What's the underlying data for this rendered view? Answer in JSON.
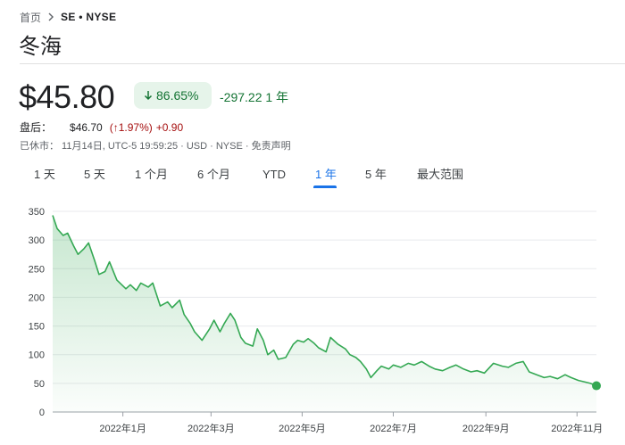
{
  "breadcrumb": {
    "home": "首页",
    "ticker": "SE • NYSE"
  },
  "company": {
    "name": "冬海"
  },
  "quote": {
    "price": "$45.80",
    "change_pct": "86.65%",
    "change_abs": "-297.22 1 年"
  },
  "after_hours": {
    "label": "盘后：",
    "price": "$46.70",
    "pct": "(↑1.97%)",
    "abs": "+0.90"
  },
  "meta": {
    "text": "已休市： 11月14日, UTC-5 19:59:25 · USD · NYSE · 免责声明"
  },
  "tabs": [
    {
      "label": "1 天"
    },
    {
      "label": "5 天"
    },
    {
      "label": "1 个月"
    },
    {
      "label": "6 个月"
    },
    {
      "label": "YTD"
    },
    {
      "label": "1 年",
      "active": true
    },
    {
      "label": "5 年"
    },
    {
      "label": "最大范围"
    }
  ],
  "colors": {
    "up_green": "#137333",
    "line_green": "#34a853",
    "down_red": "#a50e0e",
    "accent_blue": "#1a73e8"
  },
  "chart_data": {
    "type": "area",
    "ylim": [
      0,
      350
    ],
    "yticks": [
      0,
      50,
      100,
      150,
      200,
      250,
      300,
      350
    ],
    "xticks": [
      "2022年1月",
      "2022年3月",
      "2022年5月",
      "2022年7月",
      "2022年9月",
      "2022年11月"
    ],
    "x_range": [
      "2021-11-15",
      "2022-11-14"
    ],
    "xtick_dates": [
      "2022-01-01",
      "2022-03-01",
      "2022-05-01",
      "2022-07-01",
      "2022-09-01",
      "2022-11-01"
    ],
    "series": [
      {
        "points": [
          [
            "2021-11-15",
            343
          ],
          [
            "2021-11-18",
            320
          ],
          [
            "2021-11-22",
            308
          ],
          [
            "2021-11-25",
            312
          ],
          [
            "2021-11-29",
            290
          ],
          [
            "2021-12-02",
            275
          ],
          [
            "2021-12-06",
            285
          ],
          [
            "2021-12-09",
            295
          ],
          [
            "2021-12-13",
            265
          ],
          [
            "2021-12-16",
            240
          ],
          [
            "2021-12-20",
            245
          ],
          [
            "2021-12-23",
            262
          ],
          [
            "2021-12-28",
            230
          ],
          [
            "2022-01-03",
            215
          ],
          [
            "2022-01-06",
            222
          ],
          [
            "2022-01-10",
            212
          ],
          [
            "2022-01-13",
            225
          ],
          [
            "2022-01-18",
            218
          ],
          [
            "2022-01-21",
            225
          ],
          [
            "2022-01-26",
            185
          ],
          [
            "2022-01-31",
            192
          ],
          [
            "2022-02-03",
            182
          ],
          [
            "2022-02-08",
            195
          ],
          [
            "2022-02-11",
            170
          ],
          [
            "2022-02-15",
            155
          ],
          [
            "2022-02-18",
            140
          ],
          [
            "2022-02-23",
            125
          ],
          [
            "2022-02-28",
            145
          ],
          [
            "2022-03-03",
            160
          ],
          [
            "2022-03-07",
            140
          ],
          [
            "2022-03-10",
            155
          ],
          [
            "2022-03-14",
            172
          ],
          [
            "2022-03-17",
            160
          ],
          [
            "2022-03-21",
            130
          ],
          [
            "2022-03-24",
            120
          ],
          [
            "2022-03-29",
            115
          ],
          [
            "2022-04-01",
            145
          ],
          [
            "2022-04-05",
            125
          ],
          [
            "2022-04-08",
            100
          ],
          [
            "2022-04-12",
            108
          ],
          [
            "2022-04-15",
            92
          ],
          [
            "2022-04-20",
            95
          ],
          [
            "2022-04-25",
            118
          ],
          [
            "2022-04-28",
            125
          ],
          [
            "2022-05-02",
            122
          ],
          [
            "2022-05-05",
            128
          ],
          [
            "2022-05-09",
            120
          ],
          [
            "2022-05-12",
            112
          ],
          [
            "2022-05-17",
            105
          ],
          [
            "2022-05-20",
            130
          ],
          [
            "2022-05-25",
            118
          ],
          [
            "2022-05-30",
            110
          ],
          [
            "2022-06-02",
            100
          ],
          [
            "2022-06-06",
            95
          ],
          [
            "2022-06-09",
            88
          ],
          [
            "2022-06-13",
            75
          ],
          [
            "2022-06-16",
            60
          ],
          [
            "2022-06-20",
            72
          ],
          [
            "2022-06-23",
            80
          ],
          [
            "2022-06-28",
            75
          ],
          [
            "2022-07-01",
            82
          ],
          [
            "2022-07-06",
            78
          ],
          [
            "2022-07-11",
            85
          ],
          [
            "2022-07-15",
            82
          ],
          [
            "2022-07-20",
            88
          ],
          [
            "2022-07-25",
            80
          ],
          [
            "2022-07-29",
            75
          ],
          [
            "2022-08-03",
            72
          ],
          [
            "2022-08-08",
            78
          ],
          [
            "2022-08-12",
            82
          ],
          [
            "2022-08-17",
            75
          ],
          [
            "2022-08-22",
            70
          ],
          [
            "2022-08-26",
            72
          ],
          [
            "2022-08-31",
            68
          ],
          [
            "2022-09-06",
            85
          ],
          [
            "2022-09-12",
            80
          ],
          [
            "2022-09-16",
            78
          ],
          [
            "2022-09-21",
            85
          ],
          [
            "2022-09-26",
            88
          ],
          [
            "2022-09-30",
            70
          ],
          [
            "2022-10-05",
            65
          ],
          [
            "2022-10-10",
            60
          ],
          [
            "2022-10-14",
            62
          ],
          [
            "2022-10-19",
            58
          ],
          [
            "2022-10-24",
            65
          ],
          [
            "2022-10-28",
            60
          ],
          [
            "2022-11-02",
            55
          ],
          [
            "2022-11-07",
            52
          ],
          [
            "2022-11-10",
            50
          ],
          [
            "2022-11-14",
            45.8
          ]
        ]
      }
    ]
  }
}
